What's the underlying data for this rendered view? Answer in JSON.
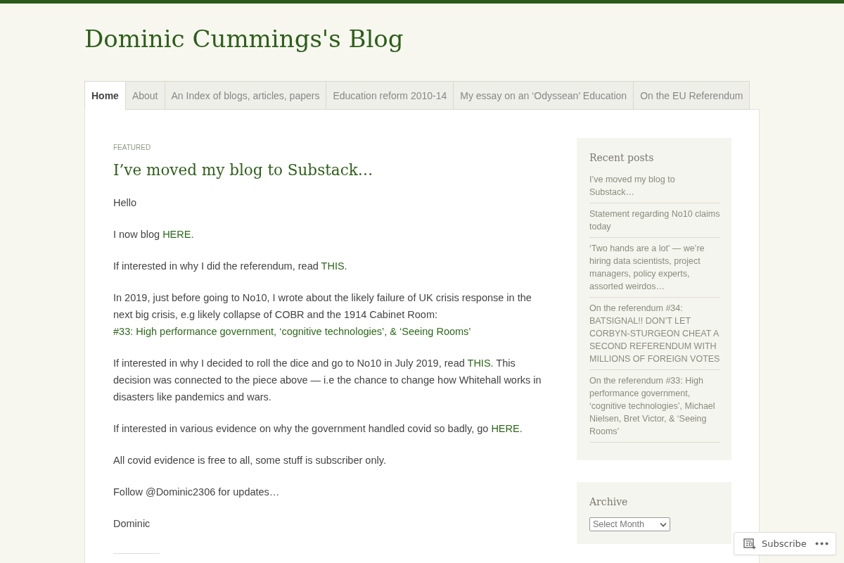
{
  "site": {
    "title": "Dominic Cummings's Blog"
  },
  "nav": [
    {
      "label": "Home",
      "selected": true
    },
    {
      "label": "About",
      "selected": false
    },
    {
      "label": "An Index of blogs, articles, papers",
      "selected": false
    },
    {
      "label": "Education reform 2010-14",
      "selected": false
    },
    {
      "label": "My essay on an ‘Odyssean’ Education",
      "selected": false
    },
    {
      "label": "On the EU Referendum",
      "selected": false
    }
  ],
  "post": {
    "tag": "FEATURED",
    "title": "I’ve moved my blog to Substack…",
    "paragraphs": [
      [
        {
          "kind": "text",
          "text": "Hello"
        }
      ],
      [
        {
          "kind": "text",
          "text": "I now blog "
        },
        {
          "kind": "link",
          "text": "HERE"
        },
        {
          "kind": "text",
          "text": "."
        }
      ],
      [
        {
          "kind": "text",
          "text": "If interested in why I did the referendum, read "
        },
        {
          "kind": "link",
          "text": "THIS"
        },
        {
          "kind": "text",
          "text": "."
        }
      ],
      [
        {
          "kind": "text",
          "text": "In 2019, just before going to No10, I wrote about the likely failure of UK crisis response in the next big crisis, e.g likely collapse of COBR and the 1914 Cabinet Room: "
        },
        {
          "kind": "link",
          "text": "#33: High performance government, ‘cognitive technologies’, & ‘Seeing Rooms’"
        }
      ],
      [
        {
          "kind": "text",
          "text": "If interested in why I decided to roll the dice and go to No10 in July 2019, read "
        },
        {
          "kind": "link",
          "text": "THIS"
        },
        {
          "kind": "text",
          "text": ". This decision was connected to the piece above — i.e the chance to change how Whitehall works in disasters like pandemics and wars."
        }
      ],
      [
        {
          "kind": "text",
          "text": "If interested in various evidence on why the government handled covid so badly, go "
        },
        {
          "kind": "link",
          "text": "HERE"
        },
        {
          "kind": "text",
          "text": "."
        }
      ],
      [
        {
          "kind": "text",
          "text": "All covid evidence is free to all, some stuff is subscriber only."
        }
      ],
      [
        {
          "kind": "text",
          "text": "Follow @Dominic2306 for updates…"
        }
      ],
      [
        {
          "kind": "text",
          "text": "Dominic"
        }
      ]
    ]
  },
  "sidebar": {
    "recent_posts": {
      "title": "Recent posts",
      "items": [
        "I’ve moved my blog to Substack…",
        "Statement regarding No10 claims today",
        "‘Two hands are a lot’ — we’re hiring data scientists, project managers, policy experts, assorted weirdos…",
        "On the referendum #34: BATSIGNAL!! DON’T LET CORBYN-STURGEON CHEAT A SECOND REFERENDUM WITH MILLIONS OF FOREIGN VOTES",
        "On the referendum #33: High performance government, ‘cognitive technologies’, Michael Nielsen, Bret Victor, & ‘Seeing Rooms’"
      ]
    },
    "archive": {
      "title": "Archive",
      "select": {
        "value": "Select Month"
      }
    }
  },
  "subscribe_bar": {
    "label": "Subscribe"
  }
}
